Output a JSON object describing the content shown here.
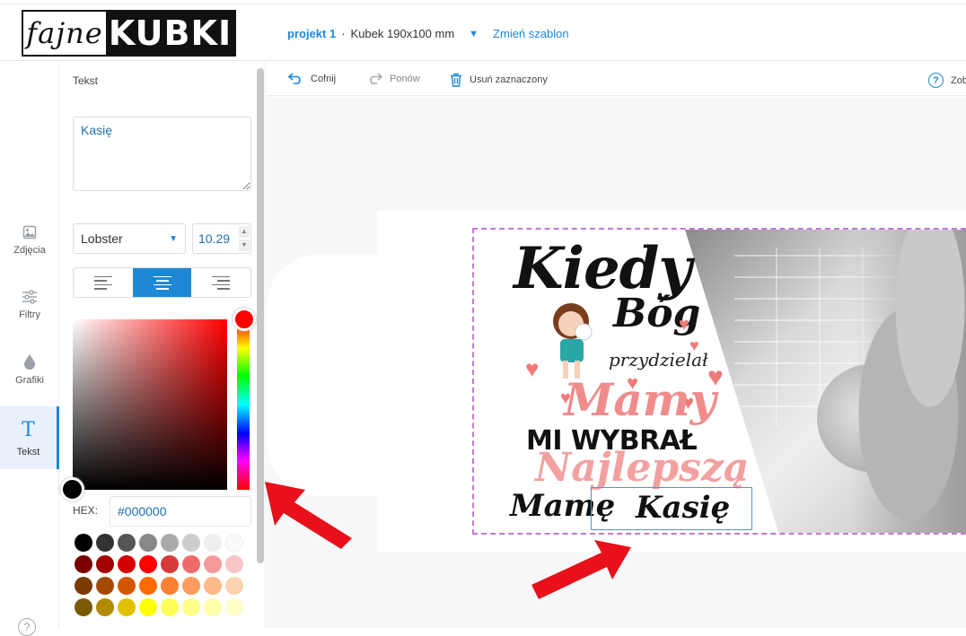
{
  "logo": {
    "part1": "fajne",
    "part2": "KUBKI"
  },
  "project": {
    "name": "projekt 1",
    "separator": "·",
    "product": "Kubek 190x100 mm",
    "change_template": "Zmień szablon"
  },
  "rail": [
    {
      "label": "Zdjęcia",
      "icon": "image-icon"
    },
    {
      "label": "Filtry",
      "icon": "sliders-icon"
    },
    {
      "label": "Grafiki",
      "icon": "drop-icon"
    },
    {
      "label": "Tekst",
      "icon": "text-icon",
      "glyph": "T"
    }
  ],
  "help_glyph": "?",
  "panel": {
    "label": "Tekst",
    "text_value": "Kasię",
    "font": "Lobster",
    "font_size": "10.29",
    "hex_label": "HEX:",
    "hex_value": "#000000",
    "swatches": [
      "#000000",
      "#333333",
      "#555555",
      "#888888",
      "#aaaaaa",
      "#cccccc",
      "#eeeeee",
      "#fafafa",
      "#7b0000",
      "#a30000",
      "#d40000",
      "#ff0000",
      "#d83a3a",
      "#f06a6a",
      "#f49a9a",
      "#f8c6c6",
      "#7a3a00",
      "#a34a00",
      "#d45500",
      "#ff6a00",
      "#ff7f33",
      "#ff9c5e",
      "#ffb888",
      "#fcd3b0",
      "#7a5a00",
      "#b08a00",
      "#e0c000",
      "#ffff00",
      "#ffff55",
      "#ffff88",
      "#ffffaa",
      "#ffffcc"
    ]
  },
  "toolbar": {
    "undo": "Cofnij",
    "redo": "Ponów",
    "delete": "Usuń zaznaczony",
    "preview": "Zob"
  },
  "design": {
    "line1": "Kiedy",
    "line2": "Bóg",
    "line3": "przydzielał",
    "line4": "Mamy",
    "line5": "MI WYBRAŁ",
    "line6": "Najlepszą",
    "line7": "Mamę",
    "line8": "Kasię"
  },
  "colors": {
    "accent": "#1e88d7",
    "pink": "#f08c8c",
    "arrow": "#e8101a"
  }
}
